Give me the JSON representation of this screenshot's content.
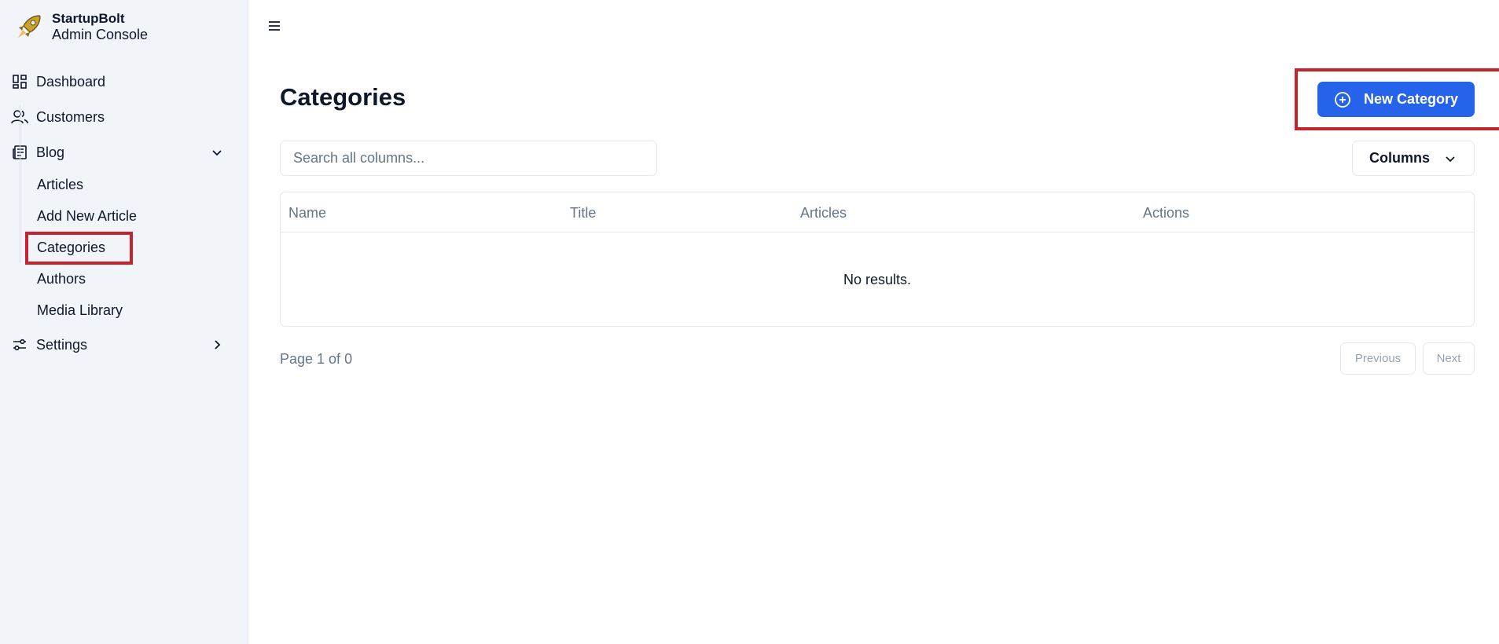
{
  "brand": {
    "name": "StartupBolt",
    "subtitle": "Admin Console",
    "logo_icon": "rocket-icon"
  },
  "sidebar": {
    "items": [
      {
        "label": "Dashboard",
        "icon": "dashboard-icon"
      },
      {
        "label": "Customers",
        "icon": "users-icon"
      },
      {
        "label": "Blog",
        "icon": "newspaper-icon",
        "expanded": true
      },
      {
        "label": "Settings",
        "icon": "sliders-icon",
        "expanded": false
      }
    ],
    "blog_subitems": [
      {
        "label": "Articles"
      },
      {
        "label": "Add New Article"
      },
      {
        "label": "Categories",
        "highlighted": true
      },
      {
        "label": "Authors"
      },
      {
        "label": "Media Library"
      }
    ]
  },
  "header": {
    "menu_icon": "hamburger-menu-icon"
  },
  "main": {
    "title": "Categories",
    "new_button_label": "New Category",
    "search_placeholder": "Search all columns...",
    "columns_button_label": "Columns",
    "table": {
      "headers": [
        "Name",
        "Title",
        "Articles",
        "Actions"
      ],
      "empty_message": "No results."
    },
    "pagination": {
      "page_info": "Page 1 of 0",
      "previous_label": "Previous",
      "next_label": "Next"
    }
  },
  "colors": {
    "accent": "#2563eb",
    "highlight": "#c8222c",
    "sidebar_bg": "#f1f5f9"
  }
}
